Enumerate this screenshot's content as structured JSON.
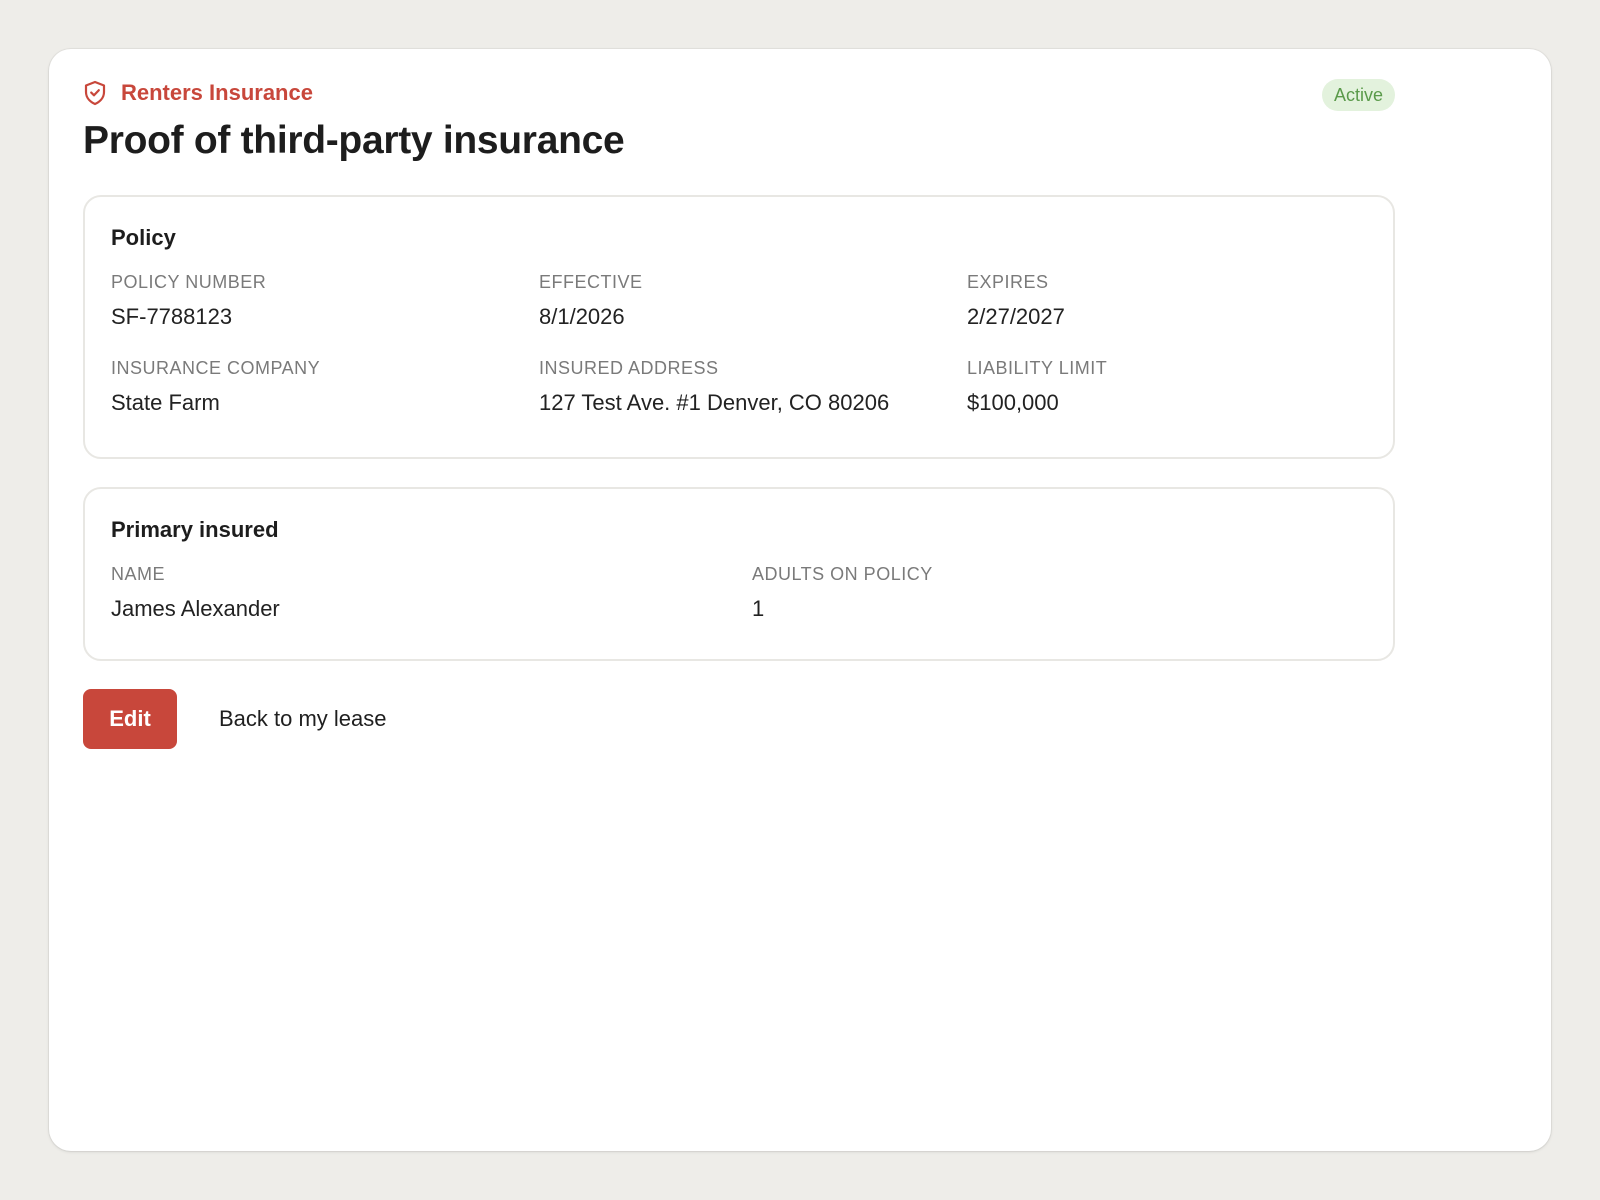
{
  "header": {
    "eyebrow": "Renters Insurance",
    "eyebrow_icon": "shield-check-icon",
    "status": "Active",
    "title": "Proof of third-party insurance"
  },
  "policy": {
    "title": "Policy",
    "fields": [
      {
        "label": "POLICY NUMBER",
        "value": "SF-7788123"
      },
      {
        "label": "EFFECTIVE",
        "value": "8/1/2026"
      },
      {
        "label": "EXPIRES",
        "value": "2/27/2027"
      },
      {
        "label": "INSURANCE COMPANY",
        "value": "State Farm"
      },
      {
        "label": "INSURED ADDRESS",
        "value": "127 Test Ave. #1 Denver, CO 80206"
      },
      {
        "label": "LIABILITY LIMIT",
        "value": "$100,000"
      }
    ]
  },
  "insured": {
    "title": "Primary insured",
    "fields": [
      {
        "label": "NAME",
        "value": "James Alexander"
      },
      {
        "label": "ADULTS ON POLICY",
        "value": "1"
      }
    ]
  },
  "actions": {
    "edit_label": "Edit",
    "back_label": "Back to my lease"
  },
  "colors": {
    "accent": "#c8473b",
    "status_bg": "#e3f2dd",
    "status_text": "#5a9a4a"
  }
}
